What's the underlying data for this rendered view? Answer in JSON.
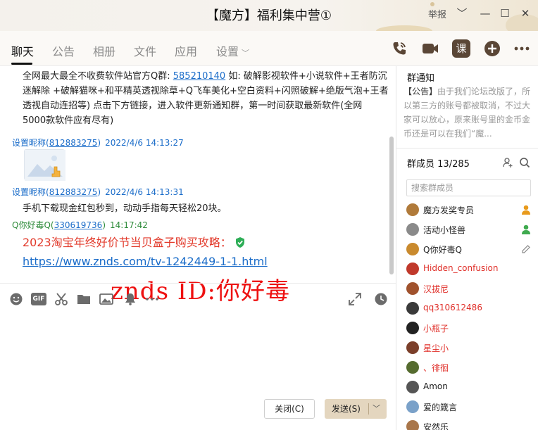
{
  "window": {
    "title": "【魔方】福利集中营①",
    "report_label": "举报",
    "controls": {
      "chevron": "﹀",
      "minimize": "—",
      "maximize": "☐",
      "close": "✕"
    }
  },
  "tabs": [
    {
      "label": "聊天",
      "active": true
    },
    {
      "label": "公告"
    },
    {
      "label": "相册"
    },
    {
      "label": "文件"
    },
    {
      "label": "应用"
    },
    {
      "label": "设置",
      "chevron": "﹀"
    }
  ],
  "toolbar_icons": [
    "phone-icon",
    "video-icon",
    "lesson-icon",
    "plus-circle-icon",
    "more-icon"
  ],
  "toolbar_lesson_label": "课",
  "chat": {
    "top_message_lines": [
      [
        "全网最大最全不收费软件站官方Q群: ",
        "585210140",
        " 如: 破解影视软件+小说软件+王者防沉"
      ],
      "迷解除  +破解猫咪+和平精英透视除草+Q飞车美化+空白资料+闪照破解+绝版气泡+王者",
      "透视自动连招等)  点击下方链接，进入软件更新通知群，第一时间获取最新软件(全网",
      "5000款软件应有尽有)"
    ],
    "messages": [
      {
        "nick": "设置昵称",
        "qq": "812883275",
        "time": "2022/4/6 14:13:27",
        "kind": "image"
      },
      {
        "nick": "设置昵称",
        "qq": "812883275",
        "time": "2022/4/6 14:13:31",
        "text": "手机下载现金红包秒到，动动手指每天轻松20块。"
      },
      {
        "nick": "Q你好毒Q",
        "qq": "330619736",
        "time": "14:17:42",
        "me": true,
        "text_red": "2023淘宝年终好价节当贝盒子购买攻略：",
        "link": "https://www.znds.com/tv-1242449-1-1.html"
      }
    ]
  },
  "watermark": "znds  ID:你好毒",
  "input_toolbar": [
    "emoji-icon",
    "gif-icon",
    "scissors-icon",
    "folder-icon",
    "image-icon",
    "bell-icon",
    "more-dots-icon",
    "expand-icon",
    "history-clock-icon"
  ],
  "input_gif_label": "GIF",
  "buttons": {
    "close": "关闭(C)",
    "send": "发送(S)",
    "send_arrow": "﹀"
  },
  "right_panel": {
    "notice_title": "群通知",
    "notice_tag": "【公告】",
    "notice_text": "由于我们论坛改版了，所以第三方的账号都被取消，不过大家可以放心，原来账号里的金币金币还是可以在我们“魔...",
    "members_label": "群成员",
    "members_count": "13/285",
    "search_placeholder": "搜索群成员",
    "members": [
      {
        "name": "魔方发奖专员",
        "color": "#222222",
        "badge": "owner"
      },
      {
        "name": "活动小怪兽",
        "color": "#222222",
        "badge": "admin"
      },
      {
        "name": "Q你好毒Q",
        "color": "#222222",
        "badge": "edit"
      },
      {
        "name": "Hidden_confusion",
        "color": "#e0302a"
      },
      {
        "name": "汉拔尼",
        "color": "#e0302a"
      },
      {
        "name": "qq310612486",
        "color": "#e0302a"
      },
      {
        "name": "小瓶子",
        "color": "#e0302a"
      },
      {
        "name": "星尘小",
        "color": "#e0302a"
      },
      {
        "name": "、徘徊",
        "color": "#e0302a"
      },
      {
        "name": "Amon",
        "color": "#222222"
      },
      {
        "name": "爱的箴言",
        "color": "#222222"
      },
      {
        "name": "安然乐",
        "color": "#222222"
      }
    ]
  }
}
